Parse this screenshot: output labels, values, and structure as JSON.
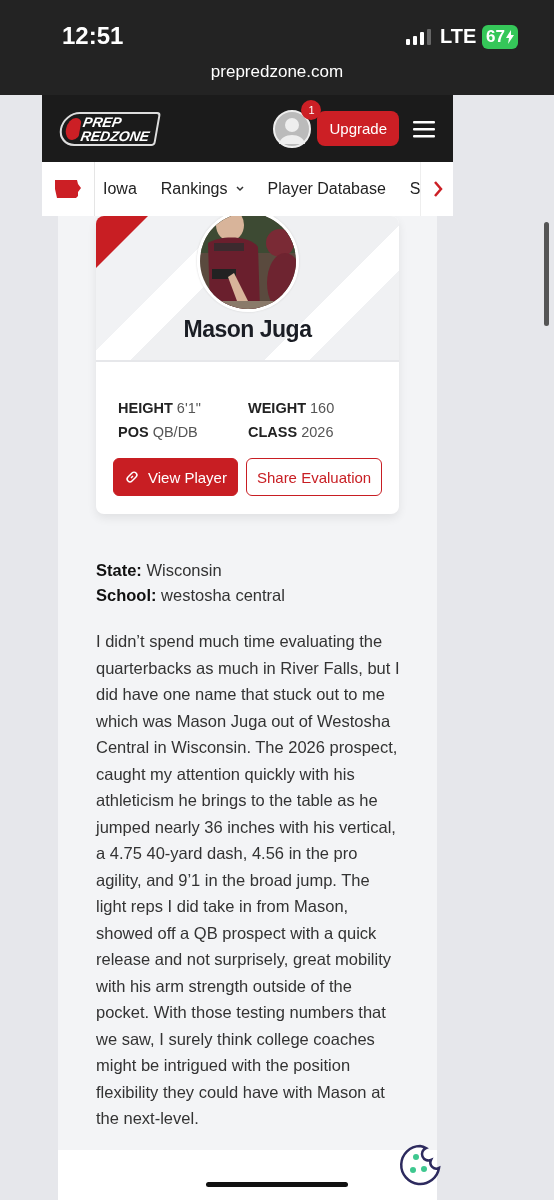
{
  "status_bar": {
    "time": "12:51",
    "network": "LTE",
    "battery": "67"
  },
  "browser": {
    "url": "prepredzone.com"
  },
  "header": {
    "logo_top": "PREP",
    "logo_bottom": "REDZONE",
    "notification_count": "1",
    "upgrade_button": "Upgrade"
  },
  "nav": {
    "items": [
      {
        "label": "Iowa",
        "kind": "link"
      },
      {
        "label": "Rankings",
        "kind": "dropdown"
      },
      {
        "label": "Player Database",
        "kind": "link"
      },
      {
        "label": "S",
        "kind": "link"
      }
    ]
  },
  "player": {
    "name": "Mason Juga",
    "stats": [
      {
        "label": "HEIGHT",
        "value": "6'1\""
      },
      {
        "label": "WEIGHT",
        "value": "160"
      },
      {
        "label": "POS",
        "value": "QB/DB"
      },
      {
        "label": "CLASS",
        "value": "2026"
      }
    ],
    "buttons": [
      {
        "label": "View Player",
        "kind": "primary"
      },
      {
        "label": "Share Evaluation",
        "kind": "outline"
      }
    ]
  },
  "details": [
    {
      "label": "State:",
      "value": "Wisconsin"
    },
    {
      "label": "School:",
      "value": "westosha central"
    }
  ],
  "evaluation": "I didn’t spend much time evaluating the quarterbacks as much in River Falls, but I did have one name that stuck out to me which was Mason Juga out of Westosha Central in Wisconsin. The 2026 prospect, caught my attention quickly with his athleticism he brings to the table as he jumped nearly 36 inches with his vertical, a 4.75 40-yard dash, 4.56 in the pro agility, and 9’1 in the broad jump. The light reps I did take in from Mason, showed off a QB prospect with a quick release and not surprisely, great mobility with his arm strength outside of the pocket. With those testing numbers that we saw, I surely think college coaches might be intrigued with the position flexibility they could have with Mason at the next-level."
}
